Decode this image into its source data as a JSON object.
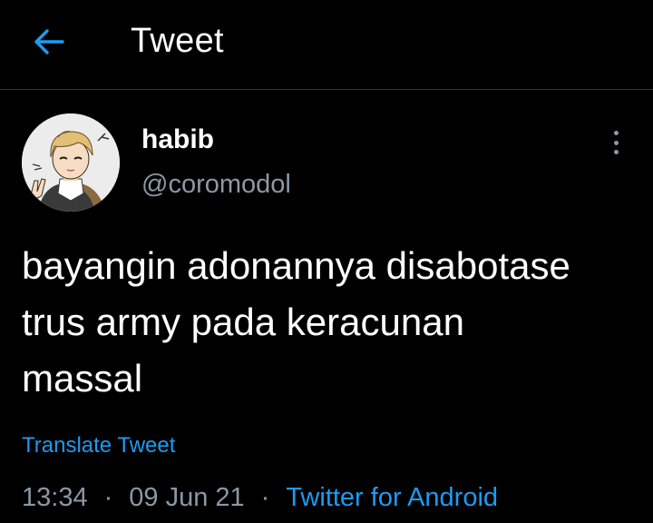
{
  "header": {
    "back_icon": "arrow-left-icon",
    "title": "Tweet"
  },
  "author": {
    "avatar": "cartoon-avatar",
    "name": "habib",
    "handle": "@coromodol"
  },
  "more_icon": "more-vertical-icon",
  "tweet": {
    "lines": [
      "bayangin adonannya disabotase",
      "trus army pada keracunan",
      "massal"
    ],
    "translate_label": "Translate Tweet",
    "time": "13:34",
    "separator": "·",
    "date": "09 Jun 21",
    "source": "Twitter for Android"
  },
  "colors": {
    "background": "#000000",
    "text": "#ffffff",
    "secondary": "#8b98a5",
    "accent": "#1d9bf0"
  }
}
